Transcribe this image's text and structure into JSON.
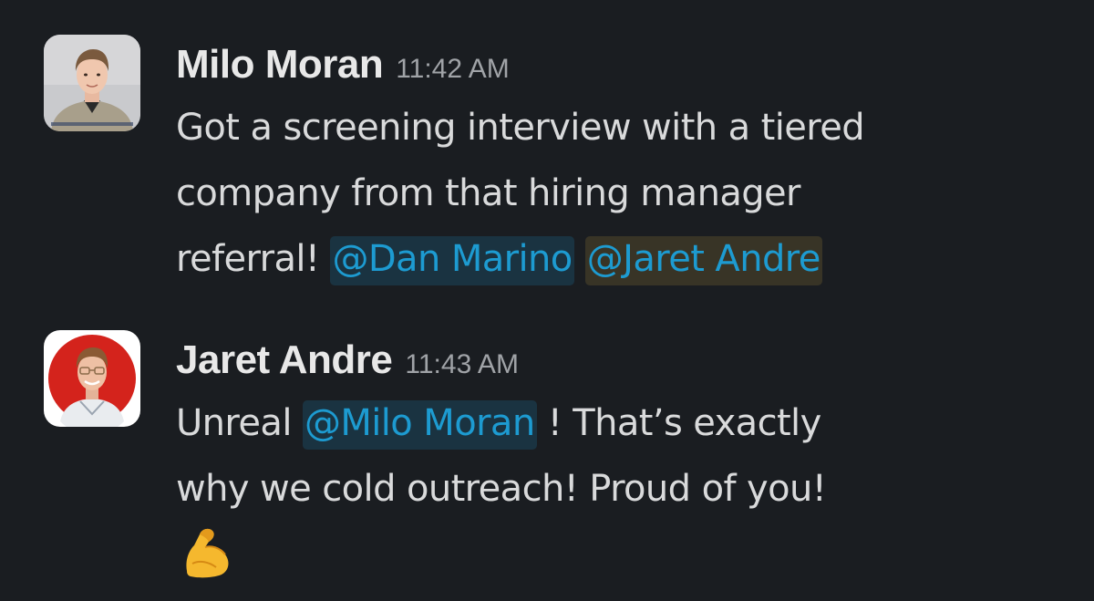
{
  "messages": [
    {
      "author": "Milo Moran",
      "time": "11:42 AM",
      "line1": "Got a screening interview with a tiered",
      "line2": "company from that hiring manager",
      "line3_prefix": "referral! ",
      "mentions": [
        "@Dan Marino",
        "@Jaret Andre"
      ],
      "avatar_colors": {
        "background": "#c8c9cc",
        "shirt": "#a79f8c"
      }
    },
    {
      "author": "Jaret Andre",
      "time": "11:43 AM",
      "line1_prefix": "Unreal ",
      "mention": "@Milo Moran",
      "line1_suffix": " ! That’s exactly",
      "line2": "why we cold outreach! Proud of you!",
      "emoji": "flexed-biceps",
      "avatar_colors": {
        "background": "#d4231c",
        "ring": "#ffffff"
      }
    }
  ],
  "colors": {
    "background": "#1a1d21",
    "text": "#d9dadb",
    "mention": "#1d9bd1",
    "timestamp": "#a0a3a7"
  }
}
